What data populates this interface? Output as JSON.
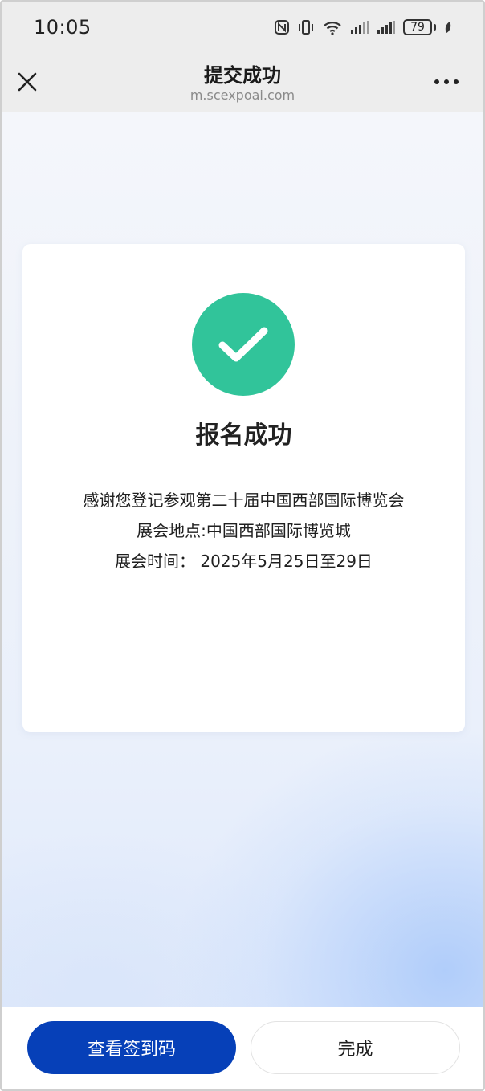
{
  "status_bar": {
    "time": "10:05",
    "battery_level": "79",
    "icons": [
      "nfc-icon",
      "vibrate-icon",
      "wifi-icon",
      "signal-icon",
      "signal-icon",
      "battery-icon",
      "leaf-icon"
    ]
  },
  "nav": {
    "title": "提交成功",
    "url": "m.scexpoai.com",
    "close_icon": "close-icon",
    "more_icon": "more-icon"
  },
  "card": {
    "icon": "checkmark-icon",
    "title": "报名成功",
    "lines": [
      "感谢您登记参观第二十届中国西部国际博览会",
      "展会地点:中国西部国际博览城",
      "展会时间：  2025年5月25日至29日"
    ]
  },
  "actions": {
    "primary_label": "查看签到码",
    "secondary_label": "完成"
  },
  "colors": {
    "success": "#31c49a",
    "primary": "#0640b8",
    "chrome": "#ededed"
  }
}
